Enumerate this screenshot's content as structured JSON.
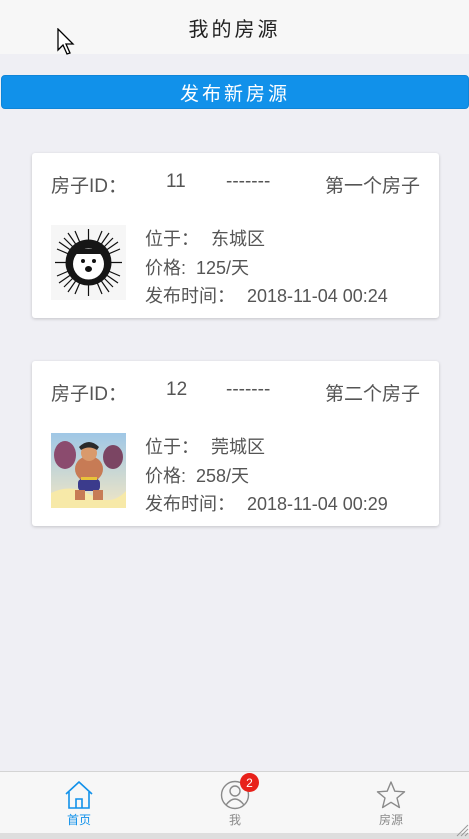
{
  "header": {
    "title": "我的房源"
  },
  "publish_button": {
    "label": "发布新房源"
  },
  "houses": [
    {
      "id_label": "房子ID：",
      "id": "11",
      "separator": "-------",
      "name": "第一个房子",
      "location_label": "位于：",
      "location": "东城区",
      "price_label": "价格:",
      "price": "125/天",
      "time_label": "发布时间：",
      "time": "2018-11-04 00:24",
      "thumbnail_icon": "hedgehog-cartoon-image"
    },
    {
      "id_label": "房子ID：",
      "id": "12",
      "separator": "-------",
      "name": "第二个房子",
      "location_label": "位于：",
      "location": "莞城区",
      "price_label": "价格:",
      "price": "258/天",
      "time_label": "发布时间：",
      "time": "2018-11-04 00:29",
      "thumbnail_icon": "anime-fighter-image"
    }
  ],
  "tabbar": {
    "items": [
      {
        "label": "首页",
        "icon": "home-icon",
        "active": true
      },
      {
        "label": "我",
        "icon": "person-icon",
        "badge": "2",
        "active": false
      },
      {
        "label": "房源",
        "icon": "star-icon",
        "active": false
      }
    ]
  },
  "colors": {
    "accent": "#1191ea",
    "badge": "#e8211a",
    "background": "#efeff4"
  }
}
